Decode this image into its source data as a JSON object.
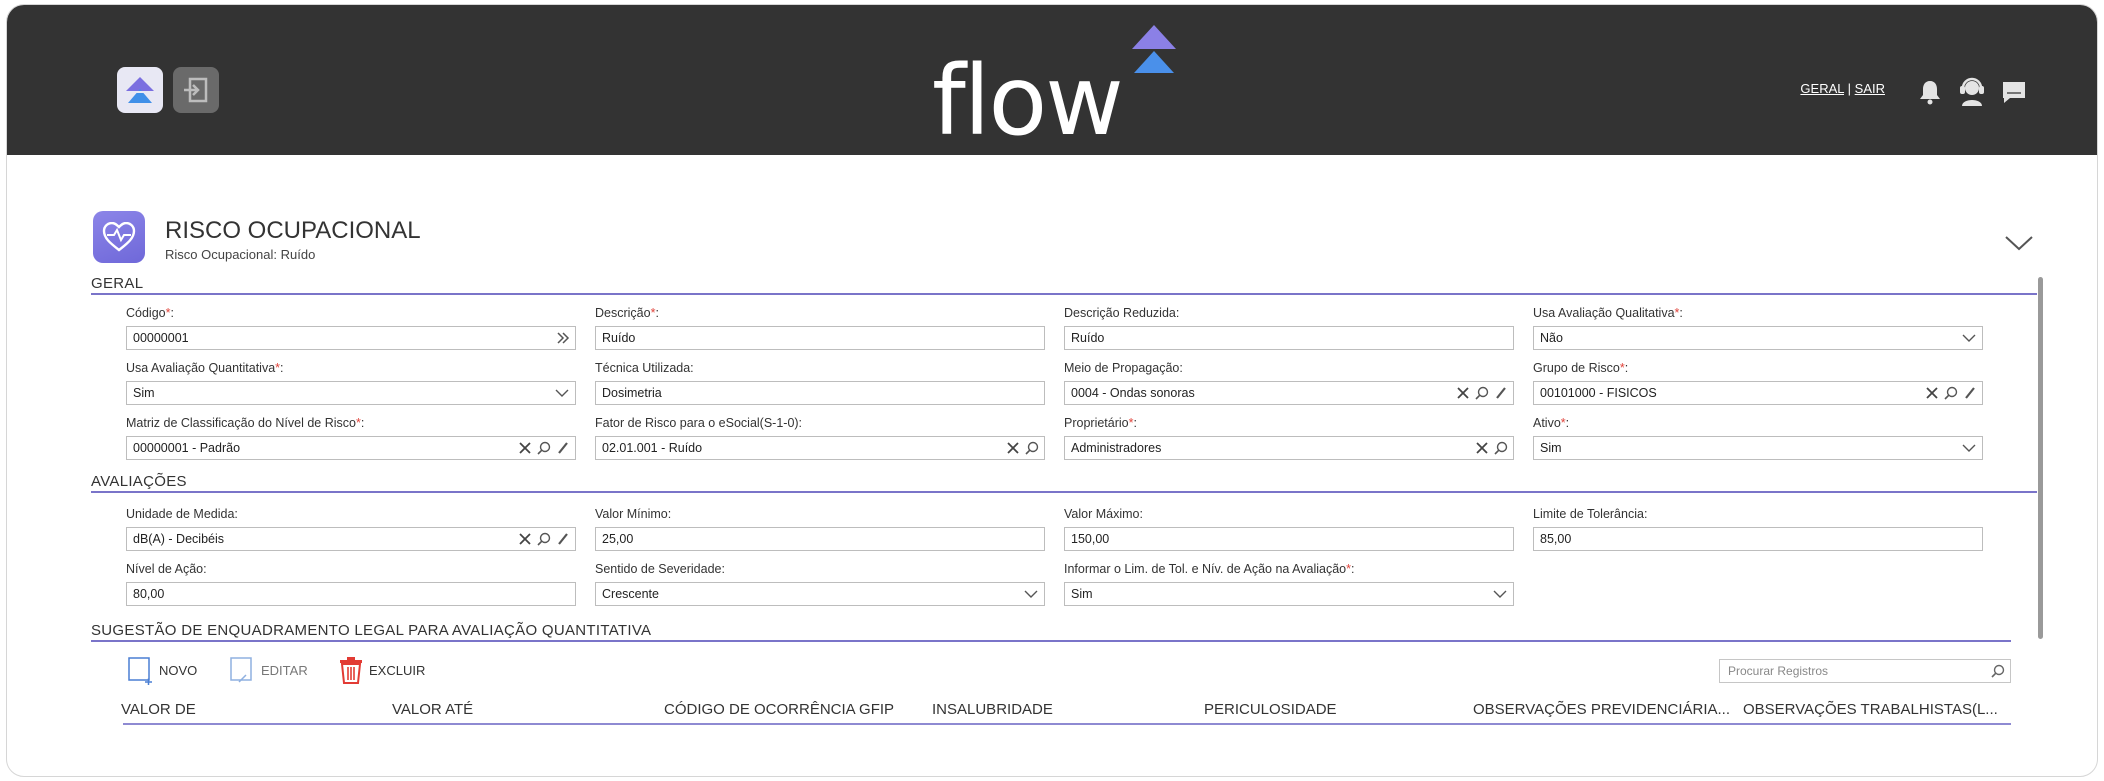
{
  "topbar": {
    "logo_text": "flow",
    "link_geral": "GERAL",
    "separator": "|",
    "link_sair": "SAIR",
    "icons": [
      "home-icon",
      "exit-icon",
      "bell-icon",
      "support-agent-icon",
      "chat-icon"
    ]
  },
  "page": {
    "title": "RISCO OCUPACIONAL",
    "subtitle": "Risco Ocupacional: Ruído",
    "required_mark": "*"
  },
  "sections": {
    "geral": "GERAL",
    "avaliacoes": "AVALIAÇÕES",
    "sugestao": "SUGESTÃO DE ENQUADRAMENTO LEGAL PARA AVALIAÇÃO QUANTITATIVA"
  },
  "geral": {
    "codigo": {
      "label": "Código",
      "value": "00000001"
    },
    "descricao": {
      "label": "Descrição",
      "value": "Ruído"
    },
    "descricao_reduzida": {
      "label": "Descrição Reduzida:",
      "value": "Ruído"
    },
    "usa_qualitativa": {
      "label": "Usa Avaliação Qualitativa",
      "value": "Não"
    },
    "usa_quantitativa": {
      "label": "Usa Avaliação Quantitativa",
      "value": "Sim"
    },
    "tecnica": {
      "label": "Técnica Utilizada:",
      "value": "Dosimetria"
    },
    "meio_propagacao": {
      "label": "Meio de Propagação:",
      "value": "0004 - Ondas sonoras"
    },
    "grupo_risco": {
      "label": "Grupo de Risco",
      "value": "00101000 - FISICOS"
    },
    "matriz": {
      "label": "Matriz de Classificação do Nível de Risco",
      "value": "00000001 - Padrão"
    },
    "fator_esocial": {
      "label": "Fator de Risco para o eSocial(S-1-0):",
      "value": "02.01.001 - Ruído"
    },
    "proprietario": {
      "label": "Proprietário",
      "value": "Administradores"
    },
    "ativo": {
      "label": "Ativo",
      "value": "Sim"
    }
  },
  "avaliacoes": {
    "unidade": {
      "label": "Unidade de Medida:",
      "value": "dB(A) - Decibéis"
    },
    "valor_minimo": {
      "label": "Valor Mínimo:",
      "value": "25,00"
    },
    "valor_maximo": {
      "label": "Valor Máximo:",
      "value": "150,00"
    },
    "limite_tolerancia": {
      "label": "Limite de Tolerância:",
      "value": "85,00"
    },
    "nivel_acao": {
      "label": "Nível de Ação:",
      "value": "80,00"
    },
    "sentido_severidade": {
      "label": "Sentido de Severidade:",
      "value": "Crescente"
    },
    "informar_limite": {
      "label": "Informar o Lim. de Tol. e Nív. de Ação na Avaliação",
      "value": "Sim"
    }
  },
  "grid": {
    "actions": {
      "novo": "NOVO",
      "editar": "EDITAR",
      "excluir": "EXCLUIR"
    },
    "search_placeholder": "Procurar Registros",
    "columns": [
      "VALOR DE",
      "VALOR ATÉ",
      "CÓDIGO DE OCORRÊNCIA GFIP",
      "INSALUBRIDADE",
      "PERICULOSIDADE",
      "OBSERVAÇÕES PREVIDENCIÁRIA...",
      "OBSERVAÇÕES TRABALHISTAS(L..."
    ]
  },
  "colors": {
    "topbar": "#333333",
    "accent": "#7a74c9",
    "required": "#e0433a",
    "delete": "#e23b34"
  }
}
